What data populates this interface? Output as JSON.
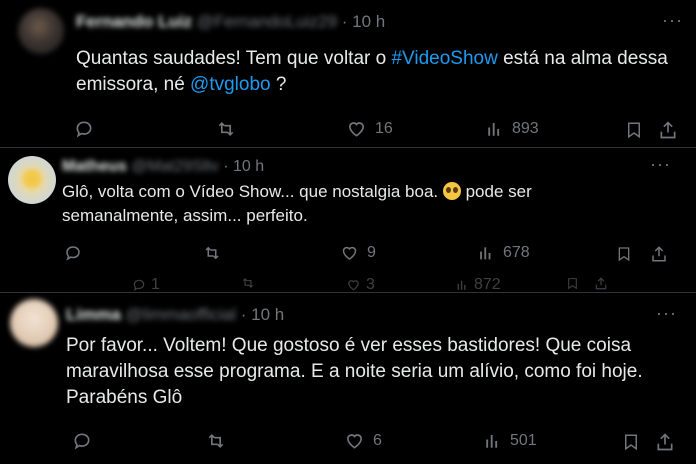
{
  "tweets": [
    {
      "name": "Fernando Luiz",
      "handle": "@FernandoLuiz29",
      "time": "· 10 h",
      "text_before": "Quantas saudades! Tem que voltar o ",
      "hashtag": "#VideoShow",
      "text_middle": " está na alma dessa\nemissora, né ",
      "mention": "@tvglobo",
      "text_after": " ?",
      "likes": "16",
      "views": "893"
    },
    {
      "name": "Matheus",
      "handle": "@Mat29Sltv",
      "time": "· 10 h",
      "text_before": "Glô, volta com o Vídeo Show... que nostalgia boa. ",
      "text_after": " pode ser\nsemanalmente, assim... perfeito.",
      "likes": "9",
      "views": "678",
      "ghost_replies": "1",
      "ghost_likes": "3",
      "ghost_views": "872"
    },
    {
      "name": "Limma",
      "handle": "@limmaofficial",
      "time": "· 10 h",
      "text": "Por favor... Voltem! Que gostoso é ver esses bastidores! Que coisa\nmaravilhosa esse programa. E a noite seria um alívio, como foi hoje.\nParabéns Glô",
      "likes": "6",
      "views": "501"
    }
  ],
  "more_label": "···",
  "colors": {
    "background": "#000000",
    "text": "#e7e9ea",
    "muted": "#71767b",
    "link": "#1d9bf0"
  },
  "icons": [
    "reply-icon",
    "retweet-icon",
    "like-icon",
    "views-icon",
    "bookmark-icon",
    "share-icon",
    "more-icon",
    "smiling-emoji-icon"
  ]
}
